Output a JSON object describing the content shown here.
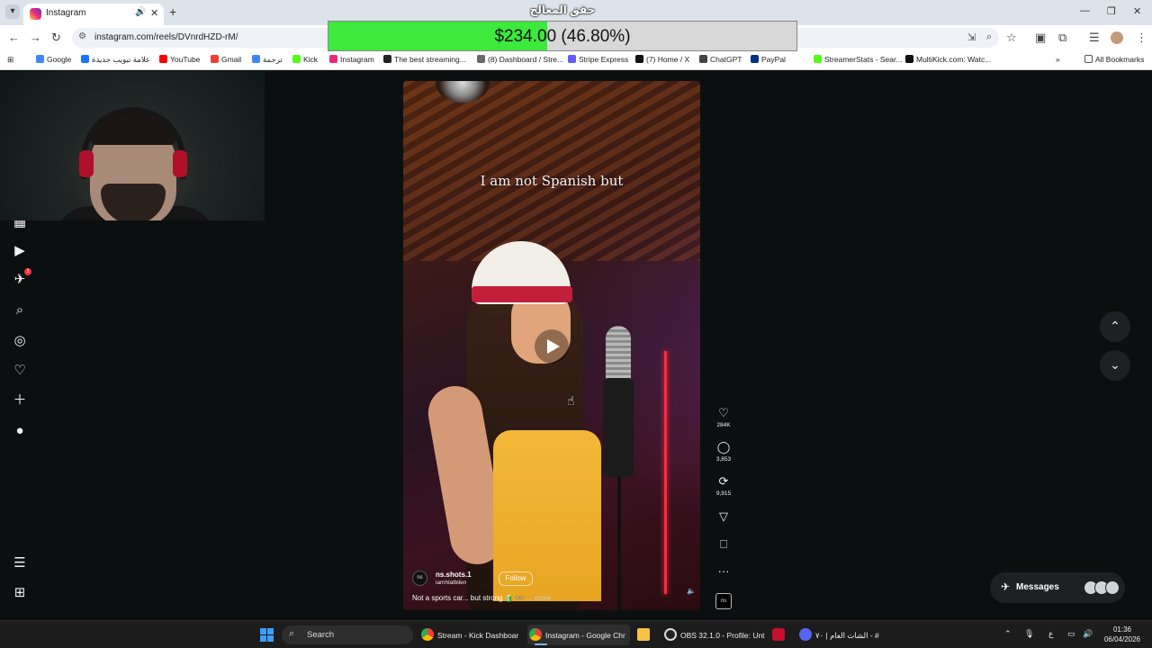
{
  "browser": {
    "tab_title": "Instagram",
    "window_title": "حقق المعالج",
    "url": "instagram.com/reels/DVnrdHZD-rM/",
    "bookmarks": [
      {
        "label": "Google",
        "color": "#4285f4"
      },
      {
        "label": "علامة تبويب جديدة",
        "color": "#1877f2"
      },
      {
        "label": "YouTube",
        "color": "#ff0000"
      },
      {
        "label": "Gmail",
        "color": "#ea4335"
      },
      {
        "label": "ترجمة",
        "color": "#4285f4"
      },
      {
        "label": "Kick",
        "color": "#53fc18"
      },
      {
        "label": "Instagram",
        "color": "#ee2a7b"
      },
      {
        "label": "The best streaming...",
        "color": "#222222"
      },
      {
        "label": "(8) Dashboard / Stre...",
        "color": "#6a6a6a"
      },
      {
        "label": "Stripe Express",
        "color": "#635bff"
      },
      {
        "label": "(7) Home / X",
        "color": "#111111"
      },
      {
        "label": "ChatGPT",
        "color": "#444444"
      },
      {
        "label": "PayPal",
        "color": "#003087"
      },
      {
        "label": "StreamerStats - Sear...",
        "color": "#53fc18"
      },
      {
        "label": "MultiKick.com: Watc...",
        "color": "#111111"
      }
    ],
    "all_bookmarks": "All Bookmarks"
  },
  "donation": {
    "amount": "$234.00 (46.80%)",
    "progress": 0.468,
    "fill_color": "#3de93d"
  },
  "sidebar_icons": [
    "instagram-logo-icon",
    "reels-icon",
    "messages-icon",
    "search-icon",
    "explore-icon",
    "notifications-icon",
    "create-icon",
    "profile-icon",
    "more-menu-icon",
    "also-from-meta-icon"
  ],
  "sidebar_badge": "1",
  "reel": {
    "caption": "I am not Spanish but",
    "username": "ns.shots.1",
    "audio_user": "iamhlalbilen",
    "follow": "Follow",
    "description": "Not a sports car... but strong 🧃 👓",
    "more": "... more",
    "likes": "284K",
    "comments": "3,853",
    "reposts": "9,915",
    "avatar_text": "ns"
  },
  "messages": {
    "label": "Messages"
  },
  "taskbar": {
    "search": "Search",
    "apps": [
      {
        "label": "Stream - Kick Dashboar",
        "active": false
      },
      {
        "label": "Instagram - Google Chr",
        "active": true
      },
      {
        "label": "OBS 32.1.0 - Profile: Unt",
        "active": false
      },
      {
        "label": "الشات العام | ٧٠ - #",
        "active": false
      }
    ],
    "ime": "ع",
    "time": "01:36",
    "date": "06/04/2026"
  }
}
